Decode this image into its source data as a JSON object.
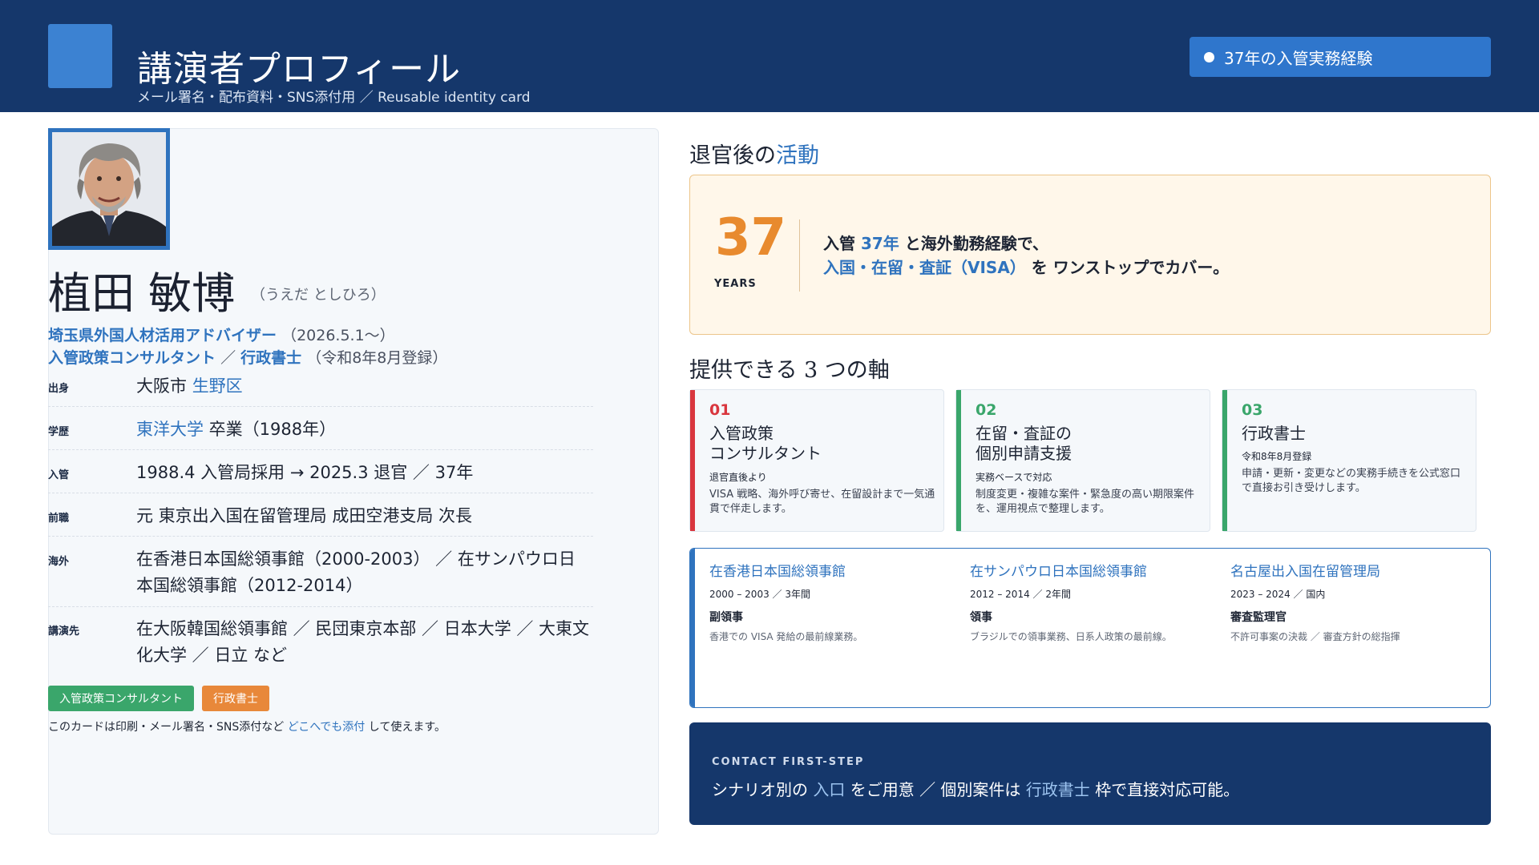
{
  "header": {
    "title": "講演者プロフィール",
    "subtitle": "メール署名・配布資料・SNS添付用 ／ Reusable identity card",
    "badge": "37年の入管実務経験"
  },
  "profile": {
    "name": "植田 敏博",
    "kana": "（うえだ としひろ）",
    "role1": {
      "title": "埼玉県外国人材活用アドバイザー",
      "note": "（2026.5.1〜）"
    },
    "role2": {
      "title_a": "入管政策コンサルタント",
      "sep": "／",
      "title_b": "行政書士",
      "note": "（令和8年8月登録）"
    },
    "rows": [
      {
        "label": "出身",
        "value_a": "大阪市 ",
        "value_b": "生野区"
      },
      {
        "label": "学歴",
        "value_a": "東洋大学",
        "value_b": " 卒業（1988年）"
      },
      {
        "label": "入管",
        "value": "1988.4 入管局採用 → 2025.3 退官 ／ 37年"
      },
      {
        "label": "前職",
        "value": "元 東京出入国在留管理局 成田空港支局 次長"
      },
      {
        "label": "海外",
        "value": "在香港日本国総領事館（2000-2003） ／ 在サンパウロ日本国総領事館（2012-2014）"
      },
      {
        "label": "講演先",
        "value": "在大阪韓国総領事館 ／ 民団東京本部 ／ 日本大学 ／ 大東文化大学 ／ 日立 など"
      }
    ],
    "tags": [
      "入管政策コンサルタント",
      "行政書士"
    ],
    "note_a": "このカードは印刷・メール署名・SNS添付など ",
    "note_b": "どこへでも添付",
    "note_c": " して使えます。"
  },
  "activity": {
    "title_a": "退官後の",
    "title_b": "活動",
    "years_num": "37",
    "years_label": "YEARS",
    "line1_a": "入管 ",
    "line1_b": "37年",
    "line1_c": " と海外勤務経験で、",
    "line2_a": "入国・在留・査証（VISA）",
    "line2_b": " を ワンストップでカバー。"
  },
  "axes": {
    "title": "提供できる 3 つの軸",
    "items": [
      {
        "num": "01",
        "title": "入管政策\nコンサルタント",
        "sub": "退官直後より",
        "desc": "VISA 戦略、海外呼び寄せ、在留設計まで一気通貫で伴走します。",
        "color": "#d9363e"
      },
      {
        "num": "02",
        "title": "在留・査証の\n個別申請支援",
        "sub": "実務ベースで対応",
        "desc": "制度変更・複雑な案件・緊急度の高い期限案件を、運用視点で整理します。",
        "color": "#3aa66b"
      },
      {
        "num": "03",
        "title": "行政書士",
        "sub": "令和8年8月登録",
        "desc": "申請・更新・変更などの実務手続きを公式窓口で直接お引き受けします。",
        "color": "#3aa66b"
      }
    ]
  },
  "career": [
    {
      "name": "在香港日本国総領事館",
      "period": "2000 – 2003 ／ 3年間",
      "role": "副領事",
      "desc": "香港での VISA 発給の最前線業務。"
    },
    {
      "name": "在サンパウロ日本国総領事館",
      "period": "2012 – 2014 ／ 2年間",
      "role": "領事",
      "desc": "ブラジルでの領事業務、日系人政策の最前線。"
    },
    {
      "name": "名古屋出入国在留管理局",
      "period": "2023 – 2024 ／ 国内",
      "role": "審査監理官",
      "desc": "不許可事案の決裁 ／ 審査方針の総指揮"
    }
  ],
  "contact": {
    "label": "CONTACT FIRST-STEP",
    "text_a": "シナリオ別の ",
    "text_b": "入口",
    "text_c": " をご用意 ／ 個別案件は ",
    "text_d": "行政書士",
    "text_e": " 枠で直接対応可能。"
  },
  "colors": {
    "navy": "#15376b",
    "accent": "#2f73be",
    "orange": "#e88a2e",
    "green": "#3aa66b",
    "red": "#d9363e"
  },
  "icons": {
    "badge": "dot-icon"
  }
}
